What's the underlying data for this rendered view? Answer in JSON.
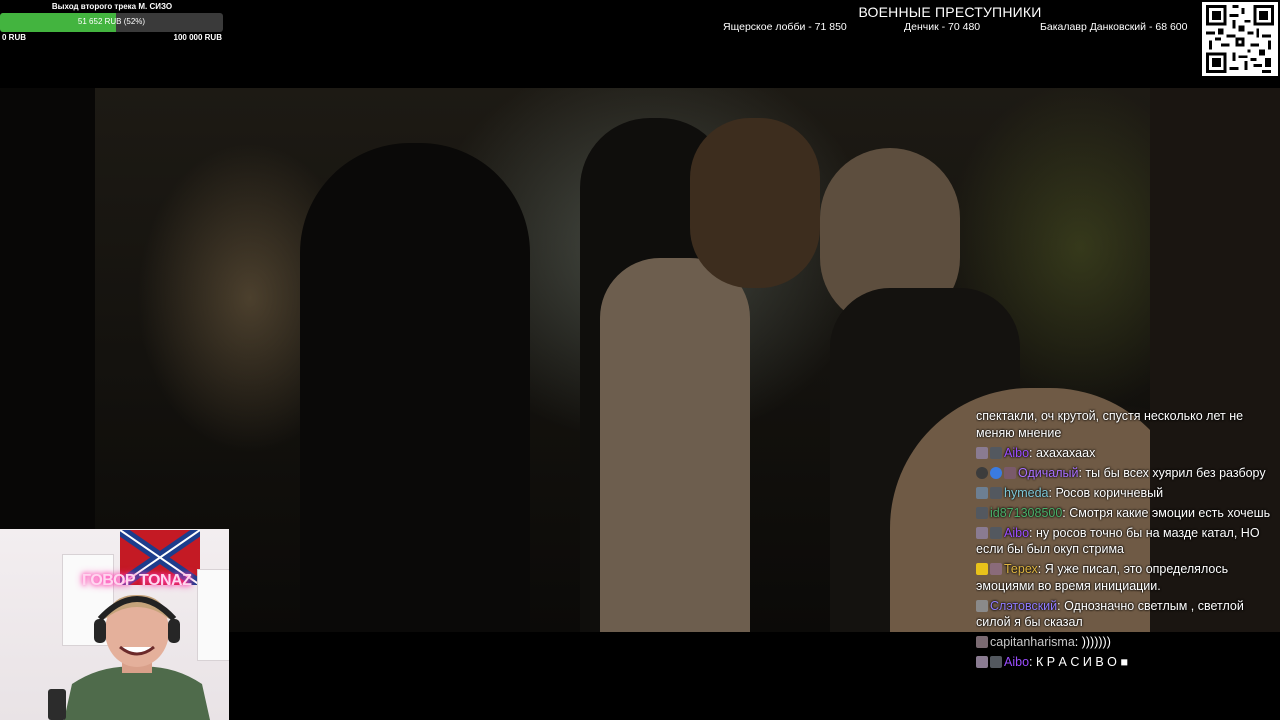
{
  "goal": {
    "title": "Выход второго трека М. СИЗО",
    "progress_text": "51 652 RUB (52%)",
    "progress_fraction": 0.52,
    "min_label": "0 RUB",
    "max_label": "100 000 RUB",
    "fill_color": "#43b43f"
  },
  "leaderboard": {
    "title": "ВОЕННЫЕ ПРЕСТУПНИКИ",
    "entries": [
      {
        "text": "Ящерское лобби - 71 850"
      },
      {
        "text": "Денчик - 70 480"
      },
      {
        "text": "Бакалавр Данковский - 68 600"
      }
    ]
  },
  "qr_icon": "qr-code-icon",
  "webcam": {
    "neon_text": "ГОВОР TONAZ"
  },
  "chat": {
    "messages": [
      {
        "user": "",
        "color": "#ffffff",
        "text": "спектакли, оч крутой, спустя несколько лет не меняю мнение"
      },
      {
        "user": "Aibo",
        "color": "#9b4dff",
        "text": "ахахахаах"
      },
      {
        "user": "Одичалый",
        "color": "#a970ff",
        "text": "ты бы всех хуярил без разбору"
      },
      {
        "user": "hymeda",
        "color": "#7ec8d8",
        "text": "Росов коричневый"
      },
      {
        "user": "id871308500",
        "color": "#49b06a",
        "text": "Смотря какие эмоции есть хочешь"
      },
      {
        "user": "Aibo",
        "color": "#9b4dff",
        "text": "ну росов точно бы на мазде катал, НО если бы был окуп стрима"
      },
      {
        "user": "Терех",
        "color": "#e0b640",
        "text": "Я уже писал, это определялось эмоциями во время инициации."
      },
      {
        "user": "Слэтовский",
        "color": "#8f7bff",
        "text": "Однозначно светлым , светлой силой я бы сказал"
      },
      {
        "user": "capitanharisma",
        "color": "#c8c8c8",
        "text": ")))))))"
      },
      {
        "user": "Aibo",
        "color": "#9b4dff",
        "text": "К Р А С И В О ■"
      }
    ]
  }
}
